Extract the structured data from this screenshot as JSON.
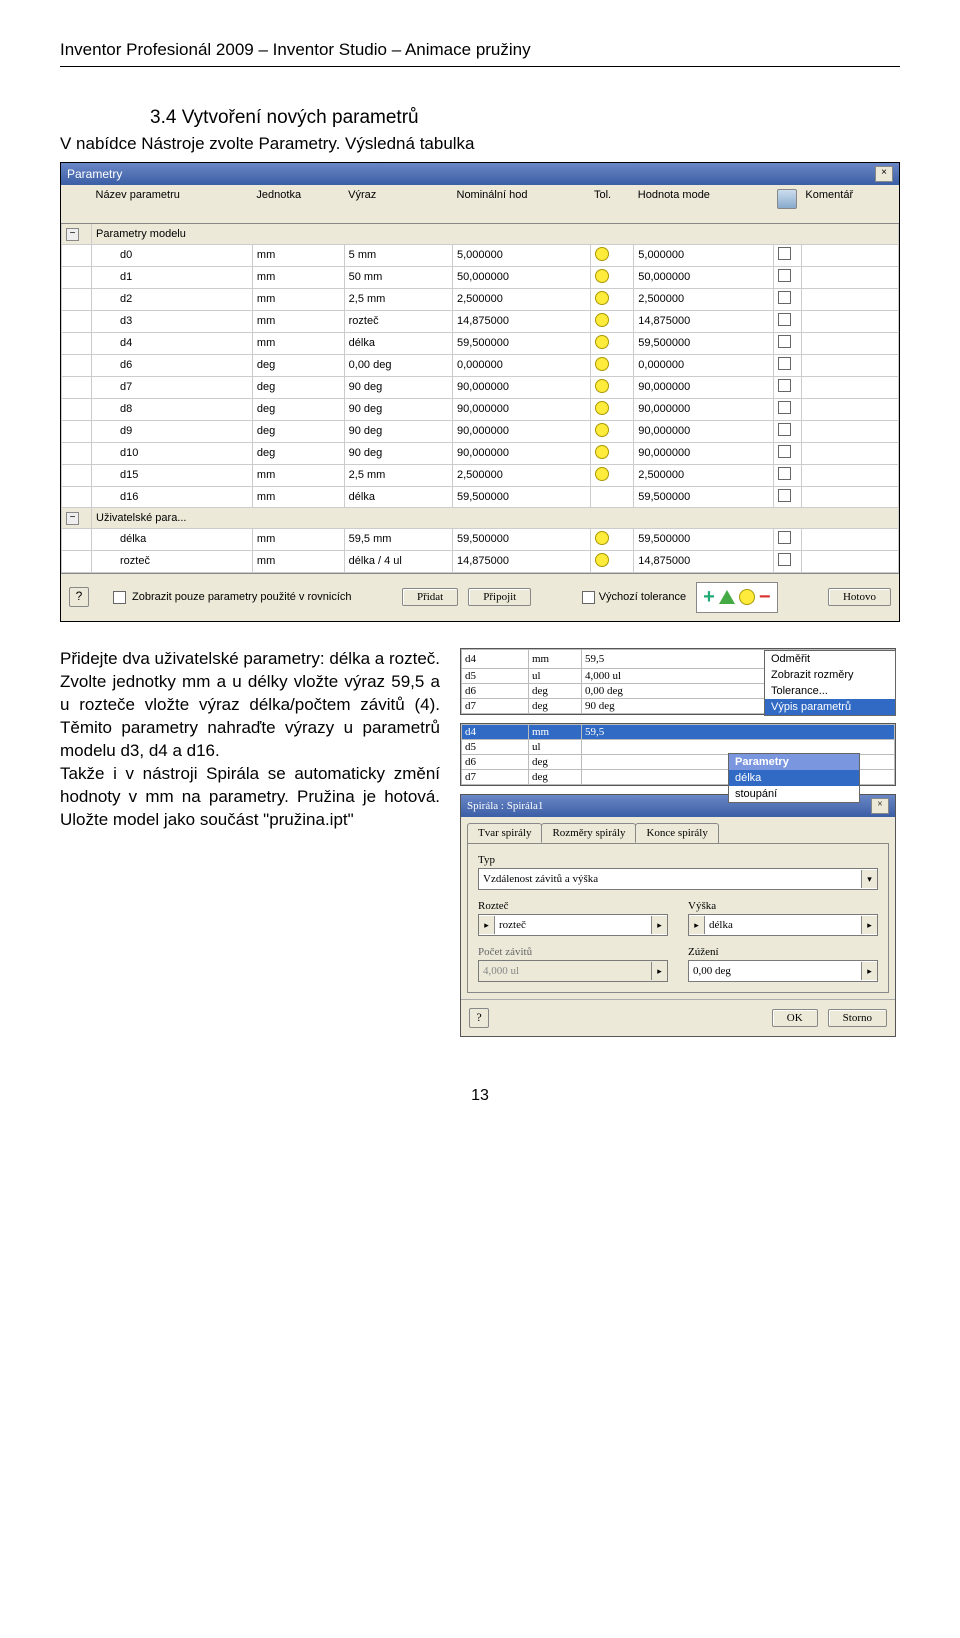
{
  "header": "Inventor Profesionál 2009 – Inventor Studio – Animace pružiny",
  "section_title": "3.4 Vytvoření nových parametrů",
  "intro_1": "V nabídce Nástroje zvolte Parametry. Výsledná tabulka",
  "param_dialog": {
    "title": "Parametry",
    "cols": {
      "name": "Název parametru",
      "unit": "Jednotka",
      "expr": "Výraz",
      "nom": "Nominální hod",
      "tol": "Tol.",
      "model": "Hodnota mode",
      "kom": "Komentář"
    },
    "section_model": "Parametry modelu",
    "section_user": "Uživatelské para...",
    "rows_model": [
      {
        "n": "d0",
        "u": "mm",
        "e": "5 mm",
        "nom": "5,000000",
        "tol": true,
        "m": "5,000000"
      },
      {
        "n": "d1",
        "u": "mm",
        "e": "50 mm",
        "nom": "50,000000",
        "tol": true,
        "m": "50,000000"
      },
      {
        "n": "d2",
        "u": "mm",
        "e": "2,5 mm",
        "nom": "2,500000",
        "tol": true,
        "m": "2,500000"
      },
      {
        "n": "d3",
        "u": "mm",
        "e": "rozteč",
        "nom": "14,875000",
        "tol": true,
        "m": "14,875000"
      },
      {
        "n": "d4",
        "u": "mm",
        "e": "délka",
        "nom": "59,500000",
        "tol": true,
        "m": "59,500000"
      },
      {
        "n": "d6",
        "u": "deg",
        "e": "0,00 deg",
        "nom": "0,000000",
        "tol": true,
        "m": "0,000000"
      },
      {
        "n": "d7",
        "u": "deg",
        "e": "90 deg",
        "nom": "90,000000",
        "tol": true,
        "m": "90,000000"
      },
      {
        "n": "d8",
        "u": "deg",
        "e": "90 deg",
        "nom": "90,000000",
        "tol": true,
        "m": "90,000000"
      },
      {
        "n": "d9",
        "u": "deg",
        "e": "90 deg",
        "nom": "90,000000",
        "tol": true,
        "m": "90,000000"
      },
      {
        "n": "d10",
        "u": "deg",
        "e": "90 deg",
        "nom": "90,000000",
        "tol": true,
        "m": "90,000000"
      },
      {
        "n": "d15",
        "u": "mm",
        "e": "2,5 mm",
        "nom": "2,500000",
        "tol": true,
        "m": "2,500000"
      },
      {
        "n": "d16",
        "u": "mm",
        "e": "délka",
        "nom": "59,500000",
        "tol": false,
        "m": "59,500000"
      }
    ],
    "rows_user": [
      {
        "n": "délka",
        "u": "mm",
        "e": "59,5 mm",
        "nom": "59,500000",
        "tol": true,
        "m": "59,500000"
      },
      {
        "n": "rozteč",
        "u": "mm",
        "e": "délka / 4 ul",
        "nom": "14,875000",
        "tol": true,
        "m": "14,875000"
      }
    ],
    "show_used": "Zobrazit pouze parametry použité v rovnicích",
    "default_tol": "Výchozí tolerance",
    "btn_add": "Přidat",
    "btn_attach": "Připojit",
    "btn_done": "Hotovo"
  },
  "left_text": "Přidejte dva uživatelské para­metry: délka a rozteč. Zvolte jednotky mm a u délky vložte výraz 59,5 a u rozteče vložte výraz délka/počtem závitů (4). Těmito parametry nahraďte vý­razy u parametrů modelu d3, d4 a d16.\nTakže i v nástroji Spirála se au­tomaticky změní hodnoty v mm na parametry. Pružina je hoto­vá. Uložte model jako součást \"pružina.ipt\"",
  "ctx1": {
    "rows": [
      {
        "n": "d4",
        "u": "mm",
        "e": "59,5"
      },
      {
        "n": "d5",
        "u": "ul",
        "e": "4,000 ul"
      },
      {
        "n": "d6",
        "u": "deg",
        "e": "0,00 deg"
      },
      {
        "n": "d7",
        "u": "deg",
        "e": "90 deg"
      }
    ],
    "menu": [
      "Odměřit",
      "Zobrazit rozměry",
      "Tolerance...",
      "Výpis parametrů"
    ],
    "hi_index": 3
  },
  "ctx2": {
    "rows": [
      {
        "n": "d4",
        "u": "mm",
        "e": "59,5"
      },
      {
        "n": "d5",
        "u": "ul",
        "e": ""
      },
      {
        "n": "d6",
        "u": "deg",
        "e": ""
      },
      {
        "n": "d7",
        "u": "deg",
        "e": ""
      }
    ],
    "hi_row": 0,
    "submenu_title": "Parametry",
    "submenu": [
      "délka",
      "stoupání"
    ],
    "sub_hi": 0
  },
  "spiral": {
    "title": "Spirála : Spirála1",
    "tabs": [
      "Tvar spirály",
      "Rozměry spirály",
      "Konce spirály"
    ],
    "active_tab": 1,
    "lbl_type": "Typ",
    "type_val": "Vzdálenost závitů a výška",
    "lbl_pitch": "Rozteč",
    "pitch_val": "rozteč",
    "lbl_height": "Výška",
    "height_val": "délka",
    "lbl_turns": "Počet závitů",
    "turns_val": "4,000 ul",
    "lbl_taper": "Zúžení",
    "taper_val": "0,00 deg",
    "btn_ok": "OK",
    "btn_cancel": "Storno"
  },
  "pagenum": "13"
}
